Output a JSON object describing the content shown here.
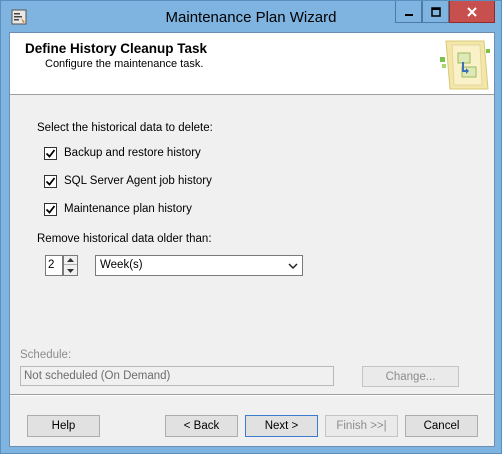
{
  "window": {
    "title": "Maintenance Plan Wizard"
  },
  "header": {
    "title": "Define History Cleanup Task",
    "subtitle": "Configure the maintenance task."
  },
  "section": {
    "select_label": "Select the historical data to delete:",
    "options": [
      {
        "label": "Backup and restore history",
        "checked": true
      },
      {
        "label": "SQL Server Agent job history",
        "checked": true
      },
      {
        "label": "Maintenance plan history",
        "checked": true
      }
    ],
    "older_than_label": "Remove historical data older than:",
    "older_than_value": "2",
    "unit_value": "Week(s)"
  },
  "schedule": {
    "label": "Schedule:",
    "value": "Not scheduled (On Demand)",
    "change_button": "Change..."
  },
  "footer": {
    "help": "Help",
    "back": "< Back",
    "next": "Next >",
    "finish": "Finish >>|",
    "cancel": "Cancel"
  },
  "colors": {
    "title_bar": "#7fb4e0",
    "close_button": "#c7504f",
    "dialog_bg": "#f0f0f0",
    "header_bg": "#ffffff"
  },
  "icons": [
    "app-icon",
    "minimize-icon",
    "maximize-icon",
    "close-icon",
    "wizard-graphic-icon",
    "checkmark-icon",
    "spin-up-icon",
    "spin-down-icon",
    "dropdown-arrow-icon"
  ]
}
